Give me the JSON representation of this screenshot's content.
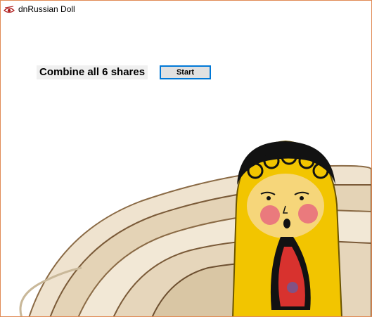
{
  "window": {
    "title": "dnRussian Doll",
    "icon": "eye-icon"
  },
  "main": {
    "label": "Combine all 6 shares",
    "start_button": "Start"
  },
  "picture": {
    "subject": "russian-doll-photo",
    "colors": {
      "doll_yellow": "#f2c500",
      "doll_red": "#d8322e",
      "hair_black": "#121212",
      "wood": "#e8d8be"
    }
  }
}
